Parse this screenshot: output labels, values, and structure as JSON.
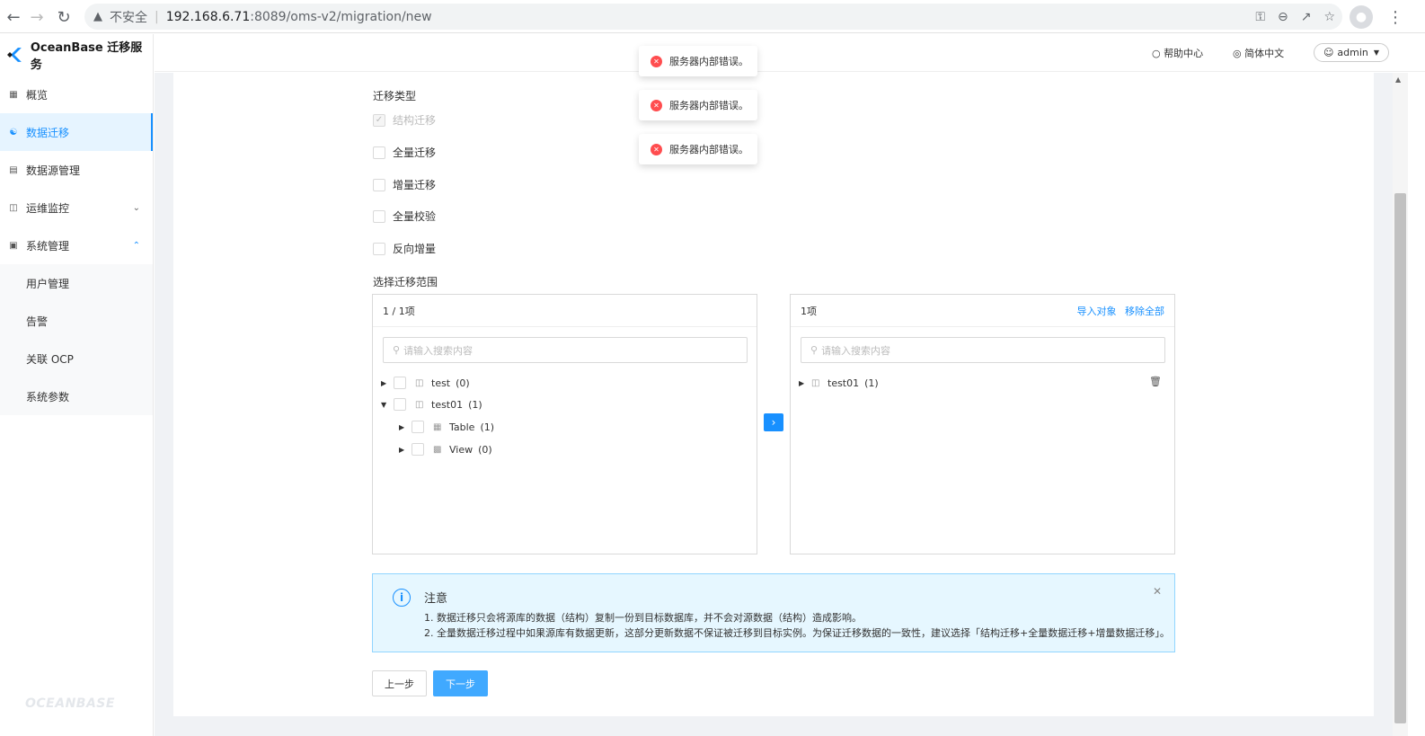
{
  "browser": {
    "insecure_label": "不安全",
    "url_host": "192.168.6.71",
    "url_path": ":8089/oms-v2/migration/new"
  },
  "sidebar": {
    "logo_text": "OceanBase 迁移服务",
    "items": [
      {
        "label": "概览",
        "icon": "grid-icon"
      },
      {
        "label": "数据迁移",
        "icon": "migration-icon"
      },
      {
        "label": "数据源管理",
        "icon": "datasource-icon"
      },
      {
        "label": "运维监控",
        "icon": "monitor-icon"
      },
      {
        "label": "系统管理",
        "icon": "system-icon"
      }
    ],
    "submenu": [
      "用户管理",
      "告警",
      "关联 OCP",
      "系统参数"
    ],
    "watermark": "OCEANBASE"
  },
  "header": {
    "help": "帮助中心",
    "language": "简体中文",
    "user": "admin"
  },
  "form": {
    "migration_type_label": "迁移类型",
    "options": [
      {
        "label": "结构迁移",
        "checked": true,
        "disabled": true
      },
      {
        "label": "全量迁移",
        "checked": false,
        "disabled": false
      },
      {
        "label": "增量迁移",
        "checked": false,
        "disabled": false
      },
      {
        "label": "全量校验",
        "checked": false,
        "disabled": false
      },
      {
        "label": "反向增量",
        "checked": false,
        "disabled": false
      }
    ],
    "scope_label": "选择迁移范围"
  },
  "left_panel": {
    "count": "1 / 1项",
    "search_placeholder": "请输入搜索内容",
    "tree": [
      {
        "name": "test",
        "count": "(0)"
      },
      {
        "name": "test01",
        "count": "(1)"
      },
      {
        "name": "Table",
        "count": "(1)"
      },
      {
        "name": "View",
        "count": "(0)"
      }
    ]
  },
  "right_panel": {
    "count": "1项",
    "import_label": "导入对象",
    "remove_all_label": "移除全部",
    "search_placeholder": "请输入搜索内容",
    "tree": [
      {
        "name": "test01",
        "count": "(1)"
      }
    ]
  },
  "alert": {
    "title": "注意",
    "line1": "1. 数据迁移只会将源库的数据（结构）复制一份到目标数据库，并不会对源数据（结构）造成影响。",
    "line2": "2. 全量数据迁移过程中如果源库有数据更新，这部分更新数据不保证被迁移到目标实例。为保证迁移数据的一致性，建议选择「结构迁移+全量数据迁移+增量数据迁移」。"
  },
  "buttons": {
    "prev": "上一步",
    "next": "下一步"
  },
  "toasts": [
    "服务器内部错误。",
    "服务器内部错误。",
    "服务器内部错误。"
  ],
  "colors": {
    "accent": "#1890ff",
    "error": "#ff4d4f",
    "alert_bg": "#e6f7ff"
  }
}
